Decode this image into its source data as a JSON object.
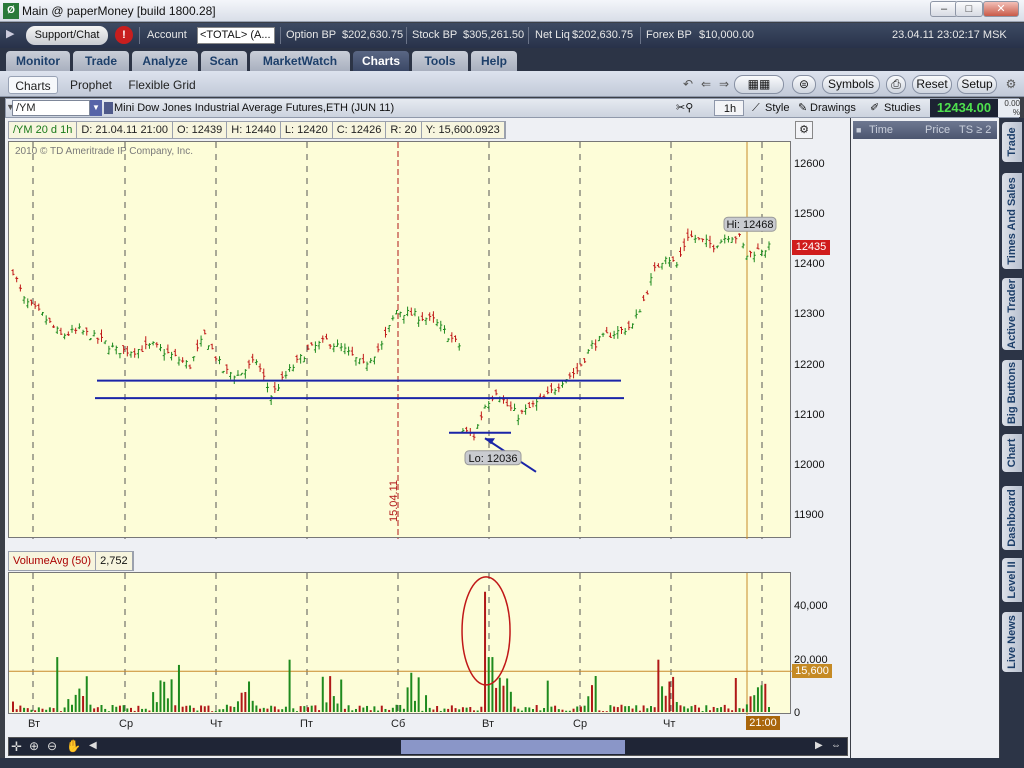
{
  "window": {
    "title": "Main @ paperMoney [build 1800.28]",
    "icon": "app-icon",
    "minimize": "minimize-icon",
    "maximize": "maximize-icon",
    "close": "close-icon"
  },
  "status": {
    "support": "Support/Chat",
    "alert": "!",
    "account_label": "Account",
    "account_value": "<TOTAL> (A...",
    "option_bp_label": "Option BP",
    "option_bp": "$202,630.75",
    "stock_bp_label": "Stock BP",
    "stock_bp": "$305,261.50",
    "net_liq_label": "Net Liq",
    "net_liq": "$202,630.75",
    "forex_bp_label": "Forex BP",
    "forex_bp": "$10,000.00",
    "datetime": "23.04.11 23:02:17 MSK"
  },
  "nav": {
    "tabs": [
      "Monitor",
      "Trade",
      "Analyze",
      "Scan",
      "MarketWatch",
      "Charts",
      "Tools",
      "Help"
    ],
    "active": "Charts"
  },
  "subnav": {
    "tabs": [
      "Charts",
      "Prophet",
      "Flexible Grid"
    ],
    "symbols": "Symbols",
    "reset": "Reset",
    "setup": "Setup"
  },
  "chart_toolbar": {
    "symbol": "/YM",
    "name": "Mini Dow Jones Industrial Average Futures,ETH (JUN 11)",
    "interval": "1h",
    "style": "Style",
    "drawings": "Drawings",
    "studies": "Studies",
    "last": "12434.00",
    "pct_change": "0.00 %"
  },
  "infobar": {
    "period": "/YM 20 d 1h",
    "date": "D: 21.04.11 21:00",
    "open": "O: 12439",
    "high": "H: 12440",
    "low": "L: 12420",
    "close": "C: 12426",
    "range": "R: 20",
    "y": "Y: 15,600.0923"
  },
  "copyright": "2010 © TD Ameritrade IP Company, Inc.",
  "annotations": {
    "hi": "Hi: 12468",
    "lo": "Lo: 12036",
    "date_marker": "15.04.11",
    "current_price": "12435",
    "vol_cursor": "15,600",
    "time_cursor": "21:00"
  },
  "volume": {
    "study": "VolumeAvg (50)",
    "value": "2,752",
    "y_ticks": [
      "40,000",
      "20,000",
      "0"
    ]
  },
  "time_and_sales": {
    "headers": [
      "Time",
      "Price",
      "TS ≥ 2"
    ]
  },
  "side_tabs": [
    "Trade",
    "Times And Sales",
    "Active Trader",
    "Big Buttons",
    "Chart",
    "Dashboard",
    "Level II",
    "Live News"
  ],
  "chart_data": {
    "type": "candlestick",
    "ylim": [
      11860,
      12640
    ],
    "y_ticks": [
      12600,
      12500,
      12400,
      12300,
      12200,
      12100,
      12000,
      11900
    ],
    "x_labels": [
      "Вт",
      "Ср",
      "Чт",
      "Пт",
      "Сб",
      "Вт",
      "Ср",
      "Чт"
    ],
    "key_levels": {
      "hi": 12468,
      "lo": 12036,
      "last": 12435
    },
    "support_lines": [
      12170,
      12135
    ],
    "path": [
      [
        0,
        12390
      ],
      [
        3,
        12330
      ],
      [
        8,
        12300
      ],
      [
        13,
        12260
      ],
      [
        18,
        12270
      ],
      [
        24,
        12250
      ],
      [
        28,
        12230
      ],
      [
        33,
        12230
      ],
      [
        38,
        12240
      ],
      [
        43,
        12220
      ],
      [
        48,
        12200
      ],
      [
        52,
        12260
      ],
      [
        57,
        12190
      ],
      [
        61,
        12180
      ],
      [
        66,
        12210
      ],
      [
        70,
        12140
      ],
      [
        75,
        12190
      ],
      [
        80,
        12230
      ],
      [
        85,
        12250
      ],
      [
        90,
        12230
      ],
      [
        95,
        12200
      ],
      [
        100,
        12240
      ],
      [
        104,
        12310
      ],
      [
        109,
        12300
      ],
      [
        114,
        12290
      ],
      [
        118,
        12260
      ],
      [
        121,
        12240
      ],
      [
        122,
        12070
      ],
      [
        125,
        12060
      ],
      [
        128,
        12120
      ],
      [
        131,
        12150
      ],
      [
        134,
        12120
      ],
      [
        137,
        12100
      ],
      [
        141,
        12120
      ],
      [
        145,
        12140
      ],
      [
        149,
        12170
      ],
      [
        153,
        12190
      ],
      [
        157,
        12240
      ],
      [
        161,
        12260
      ],
      [
        165,
        12270
      ],
      [
        168,
        12280
      ],
      [
        171,
        12330
      ],
      [
        174,
        12390
      ],
      [
        177,
        12420
      ],
      [
        180,
        12400
      ],
      [
        183,
        12460
      ],
      [
        186,
        12450
      ],
      [
        190,
        12440
      ],
      [
        194,
        12460
      ],
      [
        197,
        12455
      ],
      [
        199,
        12420
      ],
      [
        202,
        12430
      ],
      [
        205,
        12435
      ]
    ],
    "volume_ylim": [
      0,
      52000
    ],
    "volume_spikes": [
      [
        0,
        4000
      ],
      [
        12,
        21000
      ],
      [
        45,
        18000
      ],
      [
        75,
        20000
      ],
      [
        108,
        15000
      ],
      [
        128,
        46000
      ],
      [
        130,
        21000
      ],
      [
        145,
        12000
      ],
      [
        175,
        20000
      ],
      [
        196,
        13000
      ],
      [
        200,
        6000
      ]
    ]
  }
}
